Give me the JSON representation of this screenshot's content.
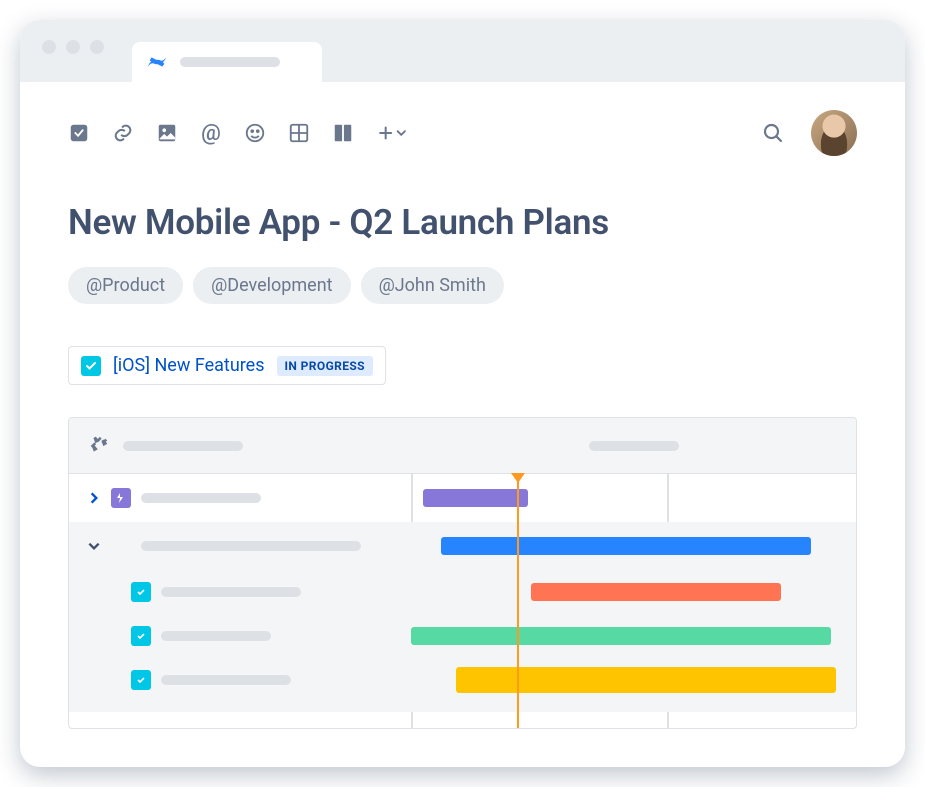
{
  "page": {
    "title": "New Mobile App - Q2 Launch Plans"
  },
  "tags": [
    "@Product",
    "@Development",
    "@John Smith"
  ],
  "linked_issue": {
    "title": "[iOS] New Features",
    "status": "IN PROGRESS"
  },
  "colors": {
    "purple": "#8777D9",
    "blue": "#2684FF",
    "orange": "#FF7452",
    "green": "#36B37E",
    "yellow": "#FFC400"
  }
}
